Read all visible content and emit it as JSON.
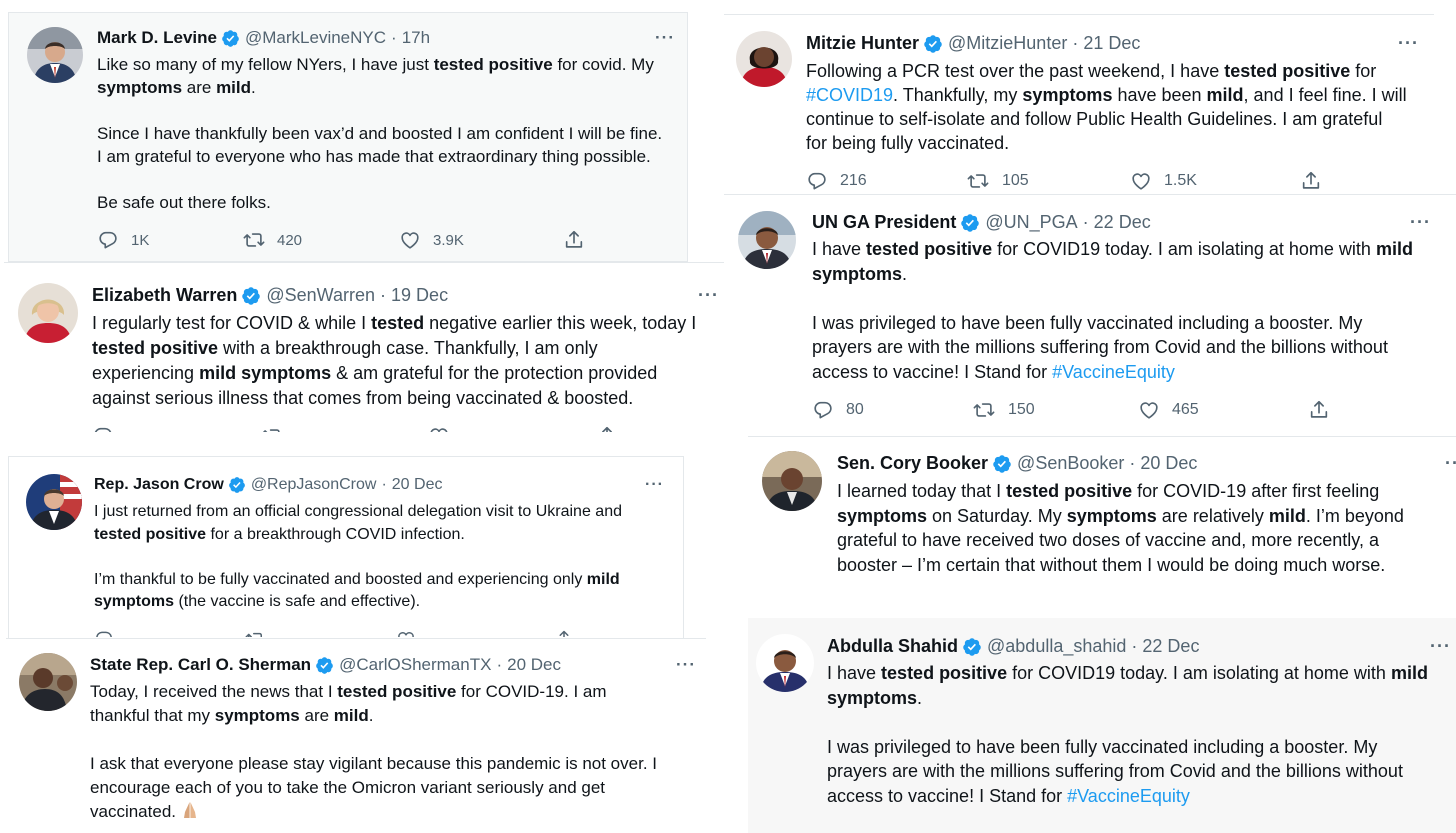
{
  "tweets": {
    "levine": {
      "name": "Mark D. Levine",
      "handle": "@MarkLevineNYC",
      "sep": "·",
      "time": "17h",
      "l1a": "Like so many of my fellow NYers, I have just ",
      "l1b": "tested positive",
      "l1c": " for covid. My",
      "l2a": "symptoms",
      "l2b": " are ",
      "l2c": "mild",
      "l2d": ".",
      "l3": "Since I have thankfully been vax’d and boosted I am confident I will be fine.",
      "l4": "I am grateful to everyone who has made that extraordinary thing possible.",
      "l5": "Be safe out there folks.",
      "replies": "1K",
      "retweets": "420",
      "likes": "3.9K"
    },
    "hunter": {
      "name": "Mitzie Hunter",
      "handle": "@MitzieHunter",
      "sep": "·",
      "time": "21 Dec",
      "l1a": "Following a PCR test over the past weekend, I have ",
      "l1b": "tested positive",
      "l1c": " for",
      "l2a": "#COVID19",
      "l2b": ". Thankfully, my ",
      "l2c": "symptoms",
      "l2d": " have been ",
      "l2e": "mild",
      "l2f": ", and I feel fine. I will",
      "l3": "continue to self-isolate and follow Public Health Guidelines. I am grateful",
      "l4": "for being fully vaccinated.",
      "replies": "216",
      "retweets": "105",
      "likes": "1.5K"
    },
    "warren": {
      "name": "Elizabeth Warren",
      "handle": "@SenWarren",
      "sep": "·",
      "time": "19 Dec",
      "l1a": "I regularly test for COVID & while I ",
      "l1b": "tested",
      "l1c": " negative earlier this week, today I",
      "l2a": "tested positive",
      "l2b": " with a breakthrough case. Thankfully, I am only",
      "l3a": "experiencing ",
      "l3b": "mild symptoms",
      "l3c": " & am grateful for the protection provided",
      "l4": "against serious illness that comes from being vaccinated & boosted."
    },
    "unpga": {
      "name": "UN GA President",
      "handle": "@UN_PGA",
      "sep": "·",
      "time": "22 Dec",
      "l1a": "I have ",
      "l1b": "tested positive",
      "l1c": " for COVID19 today. I am isolating at home with ",
      "l1d": "mild",
      "l2a": "symptoms",
      "l2b": ".",
      "l3": "I was privileged to have been fully vaccinated including a booster. My",
      "l4": "prayers are with the millions suffering from Covid and the billions without",
      "l5a": "access to vaccine! I Stand for ",
      "l5b": "#VaccineEquity",
      "replies": "80",
      "retweets": "150",
      "likes": "465"
    },
    "crow": {
      "name": "Rep. Jason Crow",
      "handle": "@RepJasonCrow",
      "sep": "·",
      "time": "20 Dec",
      "l1": "I just returned from an official congressional delegation visit to Ukraine and",
      "l2a": "tested positive",
      "l2b": " for a breakthrough COVID infection.",
      "l3a": "I’m thankful to be fully vaccinated and boosted and experiencing only ",
      "l3b": "mild",
      "l4a": "symptoms",
      "l4b": " (the vaccine is safe and effective)."
    },
    "booker": {
      "name": "Sen. Cory Booker",
      "handle": "@SenBooker",
      "sep": "·",
      "time": "20 Dec",
      "l1a": "I learned today that I ",
      "l1b": "tested positive",
      "l1c": " for COVID-19 after first feeling",
      "l2a": "symptoms",
      "l2b": " on Saturday. My ",
      "l2c": "symptoms",
      "l2d": " are relatively ",
      "l2e": "mild",
      "l2f": ". I’m beyond",
      "l3": "grateful to have received two doses of vaccine and, more recently, a",
      "l4": "booster – I’m certain that without them I would be doing much worse."
    },
    "sherman": {
      "name": "State Rep. Carl O. Sherman",
      "handle": "@CarlOShermanTX",
      "sep": "·",
      "time": "20 Dec",
      "l1a": "Today, I received the news that I ",
      "l1b": "tested positive",
      "l1c": " for COVID-19. I am",
      "l2a": "thankful that my ",
      "l2b": "symptoms",
      "l2c": " are ",
      "l2d": "mild",
      "l2e": ".",
      "l3": "I ask that everyone please stay vigilant because this pandemic is not over. I",
      "l4": "encourage each of you to take the Omicron variant seriously and get",
      "l5": "vaccinated."
    },
    "shahid": {
      "name": "Abdulla Shahid",
      "handle": "@abdulla_shahid",
      "sep": "·",
      "time": "22 Dec",
      "l1a": "I have ",
      "l1b": "tested positive",
      "l1c": " for COVID19 today. I am isolating at home with ",
      "l1d": "mild",
      "l2a": "symptoms",
      "l2b": ".",
      "l3": "I was privileged to have been fully vaccinated including a booster. My",
      "l4": "prayers are with the millions suffering from Covid and the billions without",
      "l5a": "access to vaccine! I Stand for ",
      "l5b": "#VaccineEquity"
    }
  },
  "colors": {
    "verified": "#1d9bf0",
    "hashtag": "#1d9bf0",
    "muted": "#536471",
    "shahid_bg": "#f7f7f7"
  },
  "more_label": "···"
}
